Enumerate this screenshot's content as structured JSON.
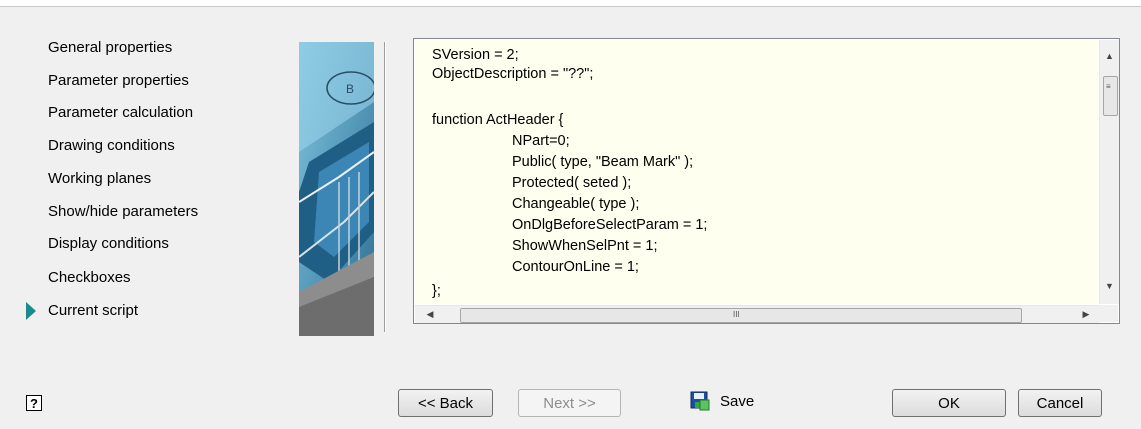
{
  "nav": {
    "items": [
      {
        "label": "General properties"
      },
      {
        "label": "Parameter properties"
      },
      {
        "label": "Parameter calculation"
      },
      {
        "label": "Drawing conditions"
      },
      {
        "label": "Working planes"
      },
      {
        "label": "Show/hide parameters"
      },
      {
        "label": "Display conditions"
      },
      {
        "label": "Checkboxes"
      },
      {
        "label": "Current script",
        "active": true
      }
    ]
  },
  "artwork": {
    "badge": "B"
  },
  "editor": {
    "lines": [
      "SVersion = 2;",
      "ObjectDescription = \"??\";",
      "",
      "function ActHeader {",
      "NPart=0;",
      "Public( type, \"Beam Mark\" );",
      "Protected( seted );",
      "Changeable( type );",
      "OnDlgBeforeSelectParam = 1;",
      "ShowWhenSelPnt = 1;",
      "ContourOnLine = 1;",
      "};"
    ],
    "scroll_grip": "III"
  },
  "buttons": {
    "back": "<< Back",
    "next": "Next >>",
    "save": "Save",
    "ok": "OK",
    "cancel": "Cancel",
    "help": "?"
  },
  "colors": {
    "accent": "#1a8a8a",
    "editor_bg": "#fffff0",
    "window_bg": "#f0f0f0"
  }
}
